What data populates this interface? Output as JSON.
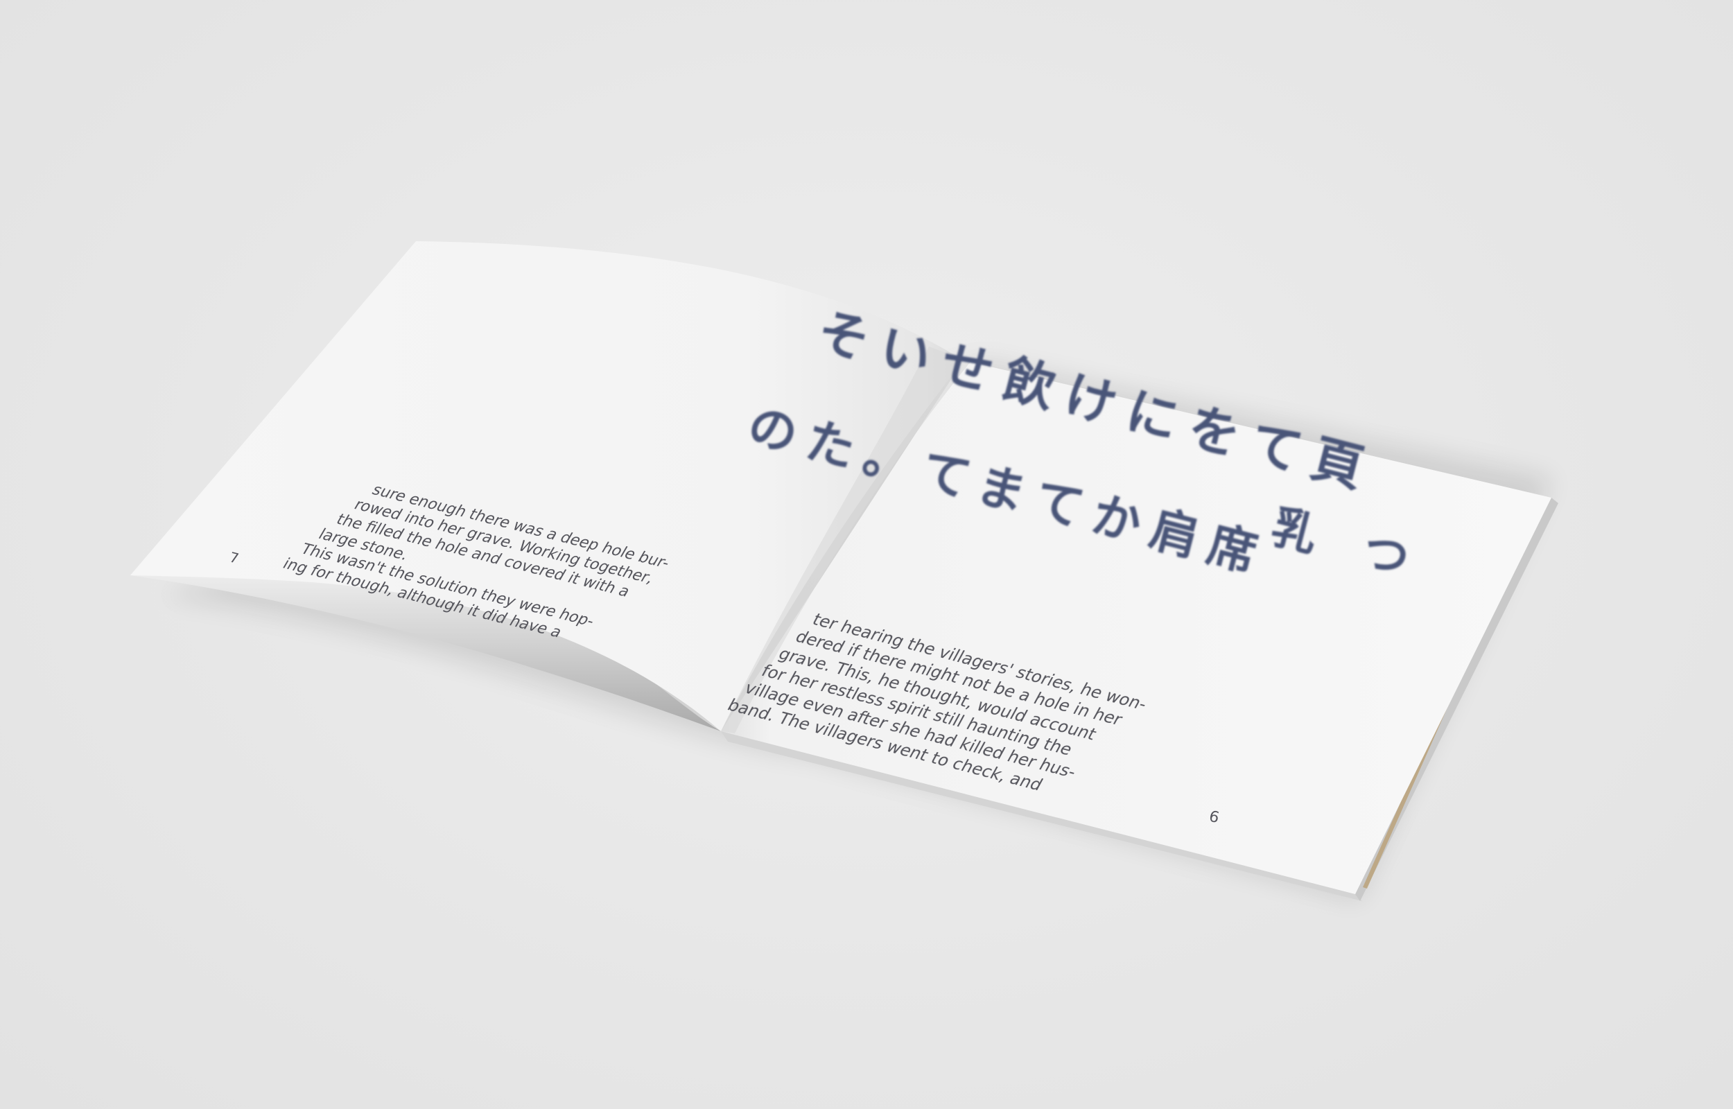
{
  "booklet": {
    "left_page": {
      "page_number": "7",
      "text_lines": [
        "sure enough there was a deep hole bur-",
        "rowed into her grave. Working together,",
        "the filled the hole and covered it with a",
        "large stone.",
        "This wasn't the solution they were hop-",
        "ing for though, although it did have a"
      ]
    },
    "right_page": {
      "page_number": "6",
      "calligraphy_lines": [
        "そいせ飲けにをて頁",
        "乳つ",
        "のた。てまてか肩席"
      ],
      "text_lines": [
        "ter hearing the villagers' stories, he won-",
        "dered if there might not be a hole in her",
        "grave. This, he thought, would account",
        "for her restless spirit still haunting the",
        "village even after she had killed her hus-",
        "band. The villagers went to check, and"
      ]
    },
    "colors": {
      "background": "#e8e8e8",
      "paper": "#f7f7f7",
      "ink_calligraphy": "#4a5478",
      "body_text": "#55555c"
    }
  }
}
